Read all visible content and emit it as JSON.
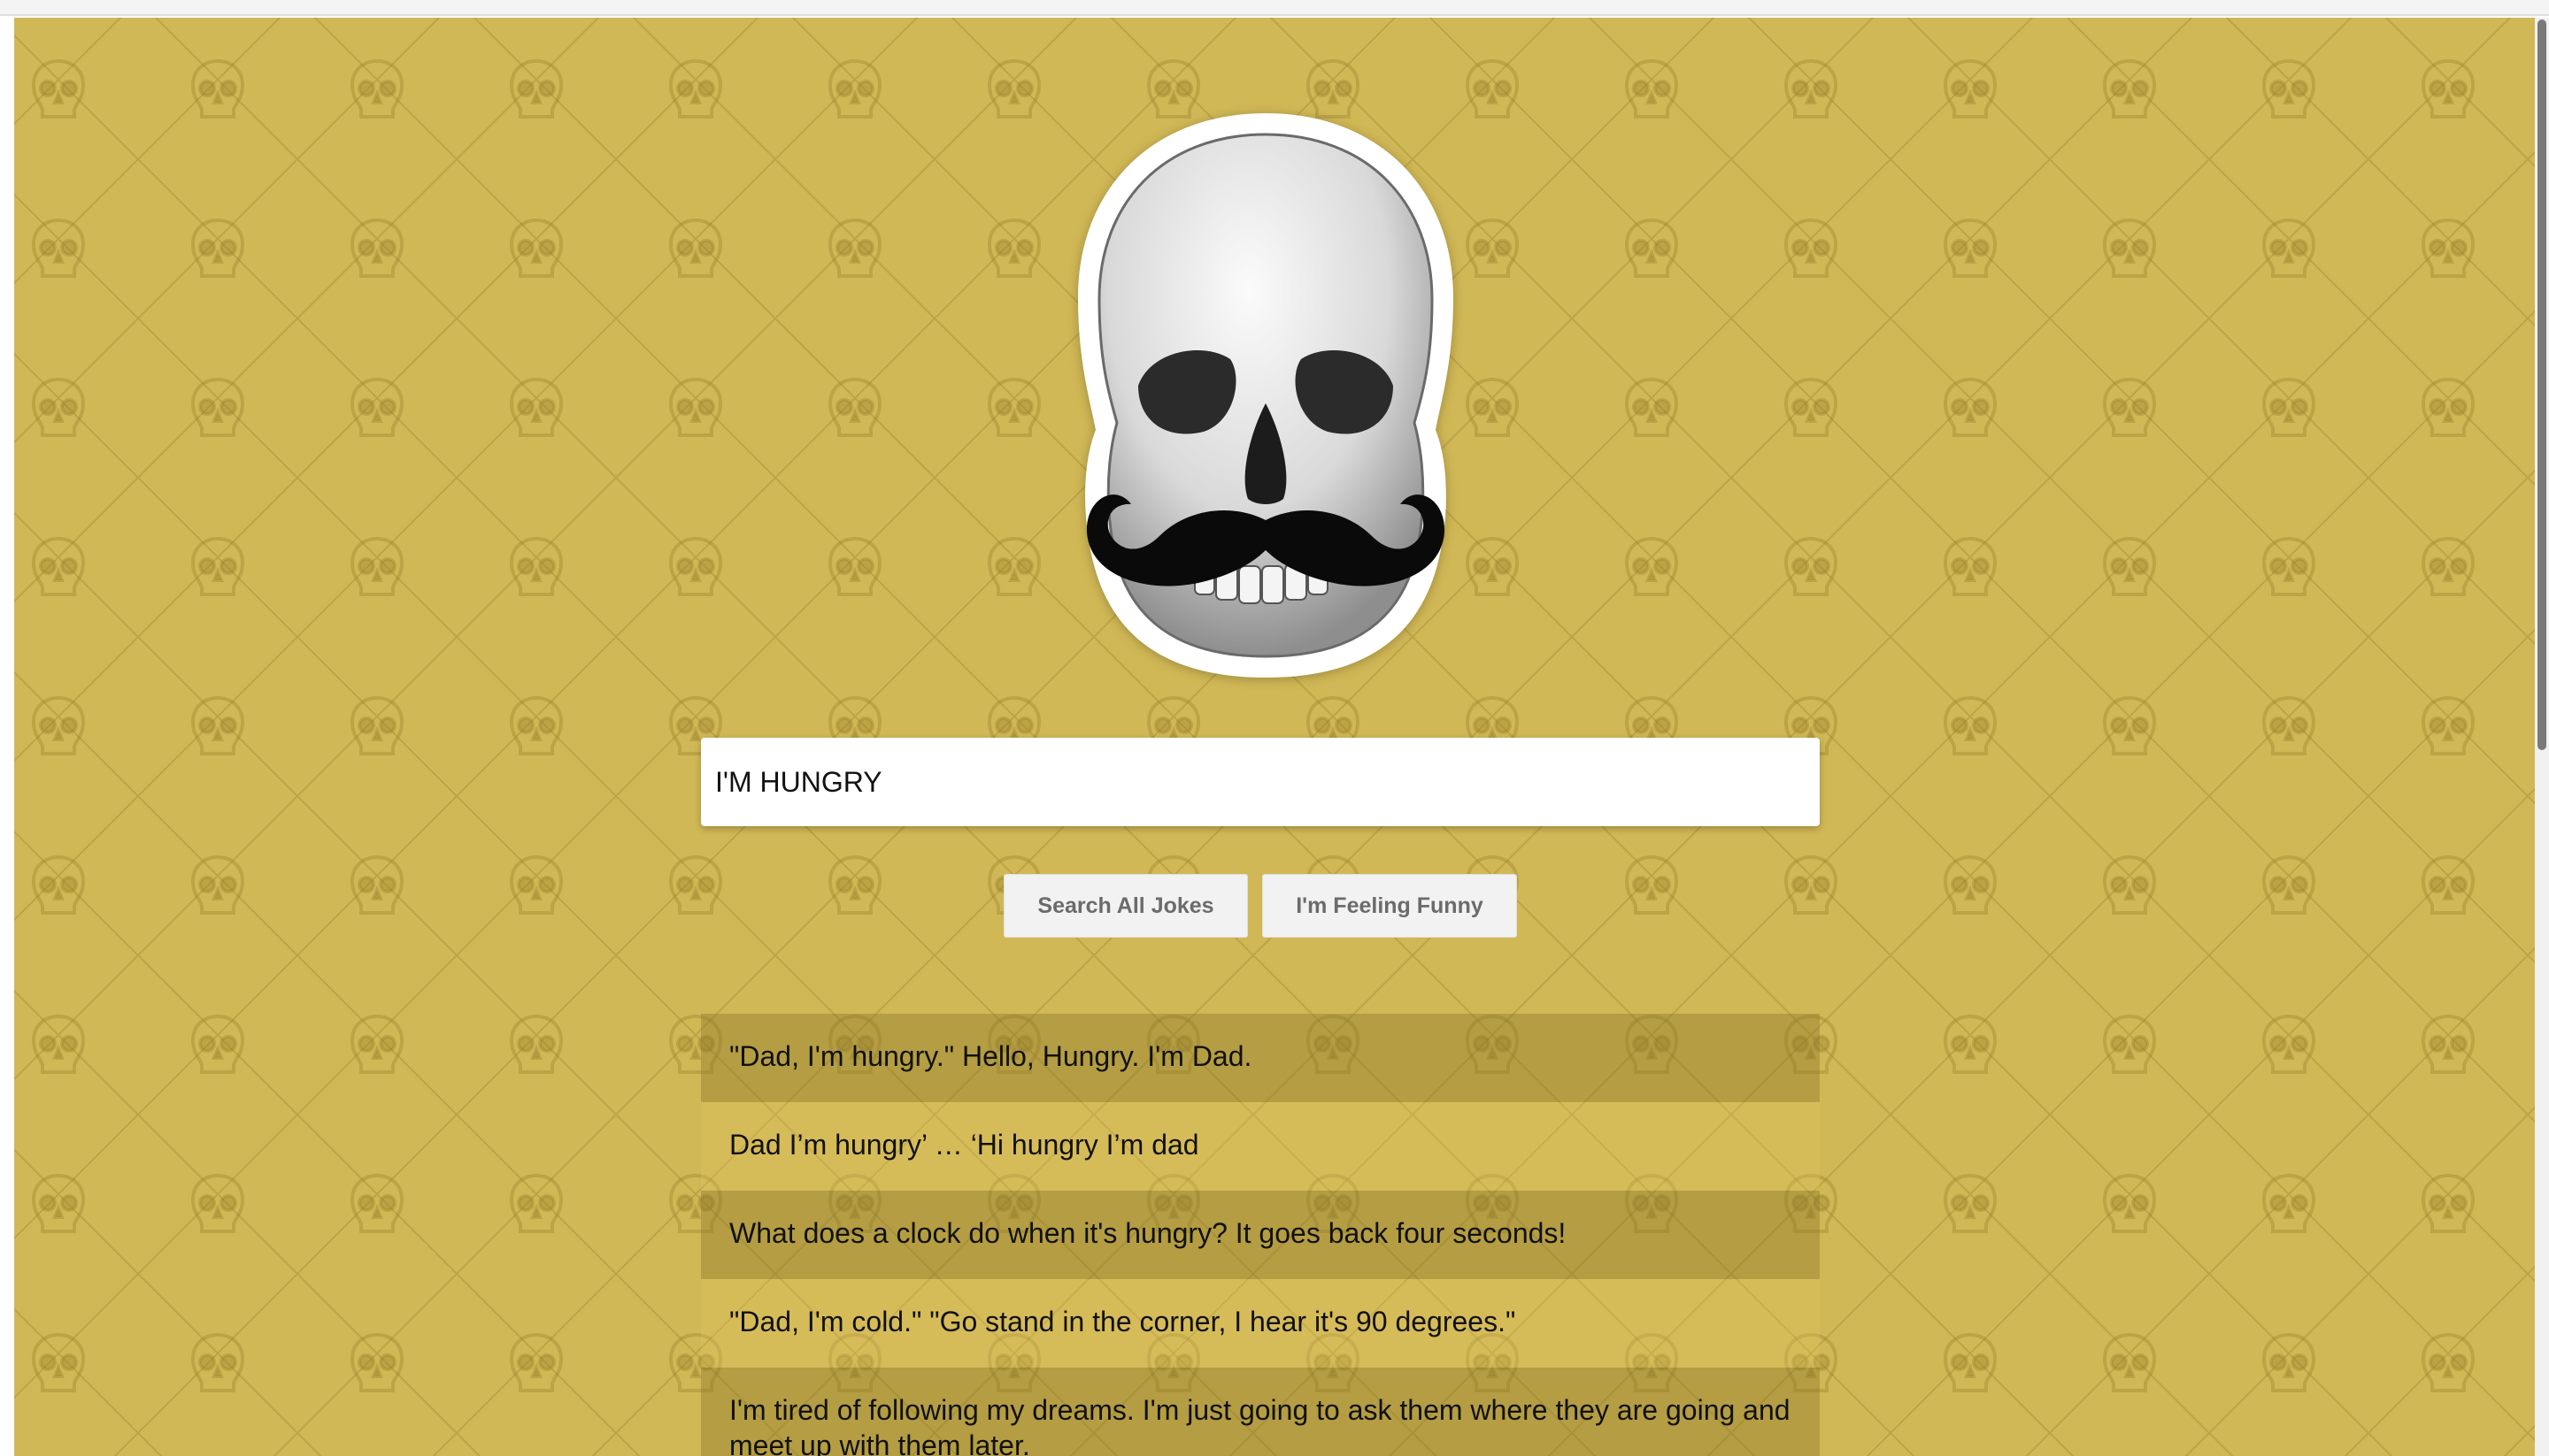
{
  "search": {
    "value": "I'M HUNGRY"
  },
  "buttons": {
    "search_all": "Search All Jokes",
    "feeling_funny": "I'm Feeling Funny"
  },
  "results": [
    "\"Dad, I'm hungry.\" Hello, Hungry. I'm Dad.",
    "Dad I’m hungry’ … ‘Hi hungry I’m dad",
    "What does a clock do when it's hungry? It goes back four seconds!",
    "\"Dad, I'm cold.\" \"Go stand in the corner, I hear it's 90 degrees.\"",
    "I'm tired of following my dreams. I'm just going to ask them where they are going and meet up with them later."
  ],
  "colors": {
    "background": "#d1b856",
    "row_dark": "#b39c45",
    "row_light": "#d8c066"
  },
  "icons": {
    "logo": "skull-with-mustache-icon",
    "pattern": "skull-pattern-icon"
  }
}
